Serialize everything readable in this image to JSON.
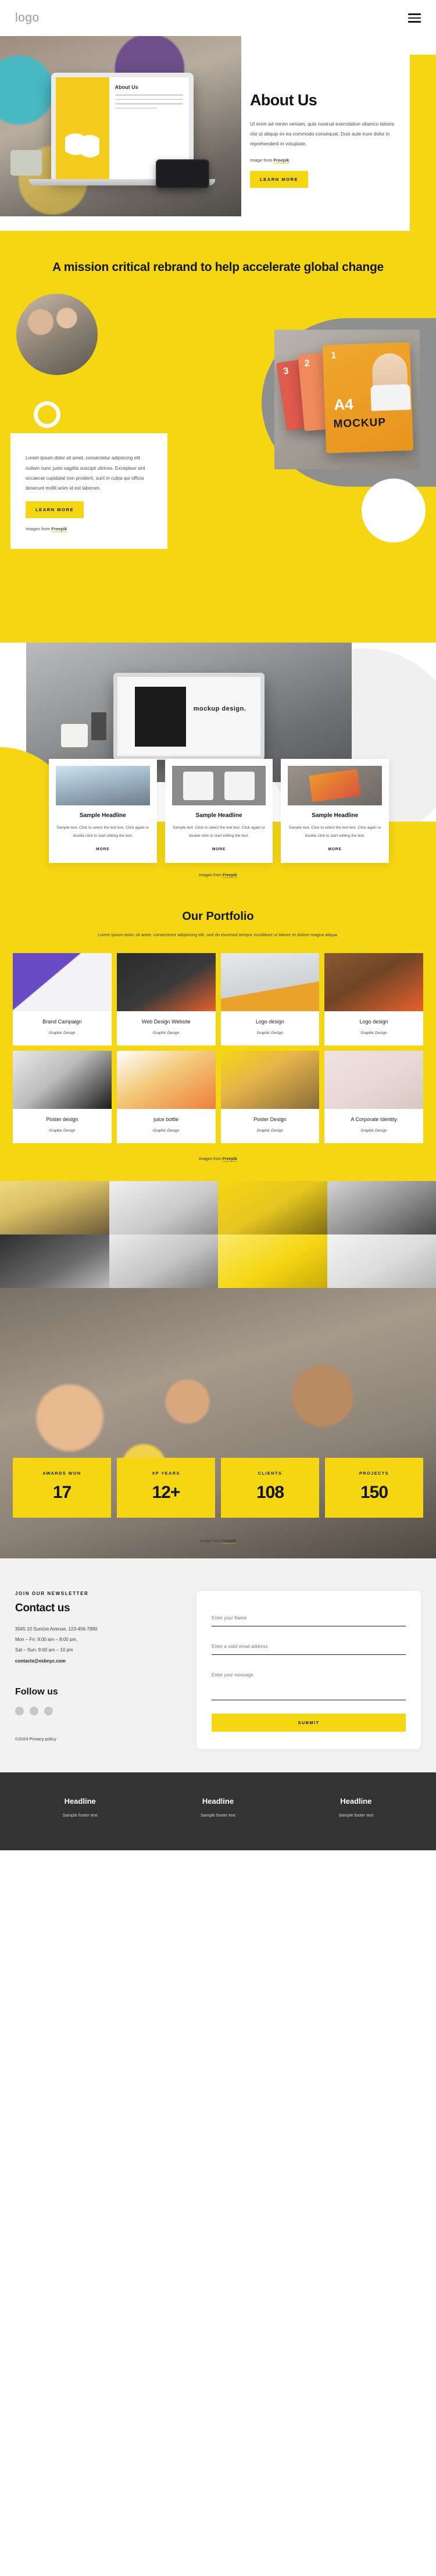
{
  "nav": {
    "logo": "logo",
    "menu_icon": "hamburger-menu-icon"
  },
  "hero": {
    "title": "About Us",
    "body": "Ut enim ad minim veniam, quis nostrud exercitation ullamco laboris nisi ut aliquip ex ea commodo consequat. Duis aute irure dolor in reprehenderit in voluptate.",
    "credit_prefix": "Image from ",
    "credit_link": "Freepik",
    "cta": "LEARN MORE",
    "laptop_screen_title": "About Us"
  },
  "mission": {
    "heading": "A mission critical rebrand to help accelerate global change",
    "card_body": "Lorem ipsum dolor sit amet, consectetur adipiscing elit nullam nunc justo sagittis suscipit ultrices. Excepteur sint occaecat cupidatat non proident, sunt in culpa qui officia deserunt mollit anim id est laborum.",
    "cta": "LEARN MORE",
    "credit_prefix": "Images from ",
    "credit_link": "Freepik",
    "mockup_numbers": [
      "1",
      "2",
      "3"
    ],
    "mockup_size": "A4",
    "mockup_word": "MOCKUP"
  },
  "showcase": {
    "screen_text": "mockup design.",
    "credit_prefix": "Images from ",
    "credit_link": "Freepik",
    "cards": [
      {
        "title": "Sample Headline",
        "body": "Sample text. Click to select the text box. Click again or double click to start editing the text.",
        "more": "MORE"
      },
      {
        "title": "Sample Headline",
        "body": "Sample text. Click to select the text box. Click again or double click to start editing the text.",
        "more": "MORE"
      },
      {
        "title": "Sample Headline",
        "body": "Sample text. Click to select the text box. Click again or double click to start editing the text.",
        "more": "MORE"
      }
    ]
  },
  "portfolio": {
    "heading": "Our Portfolio",
    "subtitle": "Lorem ipsum dolor sit amet, consectetur adipiscing elit, sed do eiusmod tempor incididunt ut labore et dolore magna aliqua.",
    "credit_prefix": "Images from ",
    "credit_link": "Freepik",
    "items": [
      {
        "title": "Brand Campaign",
        "category": "Graphic Design"
      },
      {
        "title": "Web Design Website",
        "category": "Graphic Design"
      },
      {
        "title": "Logo design",
        "category": "Graphic Design"
      },
      {
        "title": "Logo design",
        "category": "Graphic Design"
      },
      {
        "title": "Poster design",
        "category": "Graphic Design"
      },
      {
        "title": "juice bottle",
        "category": "Graphic Design"
      },
      {
        "title": "Poster Design",
        "category": "Graphic Design"
      },
      {
        "title": "A Corporate Identity",
        "category": "Graphic Design"
      }
    ]
  },
  "stats": {
    "credit_prefix": "Image from ",
    "credit_link": "Freepik",
    "items": [
      {
        "label": "AWARDS WON",
        "value": "17"
      },
      {
        "label": "XP YEARS",
        "value": "12+"
      },
      {
        "label": "CLIENTS",
        "value": "108"
      },
      {
        "label": "PROJECTS",
        "value": "150"
      }
    ]
  },
  "contact": {
    "eyebrow": "JOIN OUR NEWSLETTER",
    "heading": "Contact us",
    "address": "3045 10 Sunrize Avenue, 123-456-7890",
    "hours_weekday": "Mon – Fri: 9:00 am – 8:00 pm,",
    "hours_weekend": "Sat – Sun: 9:00 am – 10 pm",
    "email": "contacts@esbnyc.com",
    "follow_heading": "Follow us",
    "copyright": "©2024 Privacy policy",
    "form": {
      "name_placeholder": "Enter your Name",
      "email_placeholder": "Enter a valid email address",
      "message_placeholder": "Enter your message",
      "submit": "SUBMIT"
    }
  },
  "footer": {
    "columns": [
      {
        "title": "Headline",
        "text": "Sample footer text"
      },
      {
        "title": "Headline",
        "text": "Sample footer text"
      },
      {
        "title": "Headline",
        "text": "Sample footer text"
      }
    ]
  },
  "colors": {
    "accent": "#f5d613",
    "dark": "#333333",
    "muted": "#8f8f8f"
  }
}
